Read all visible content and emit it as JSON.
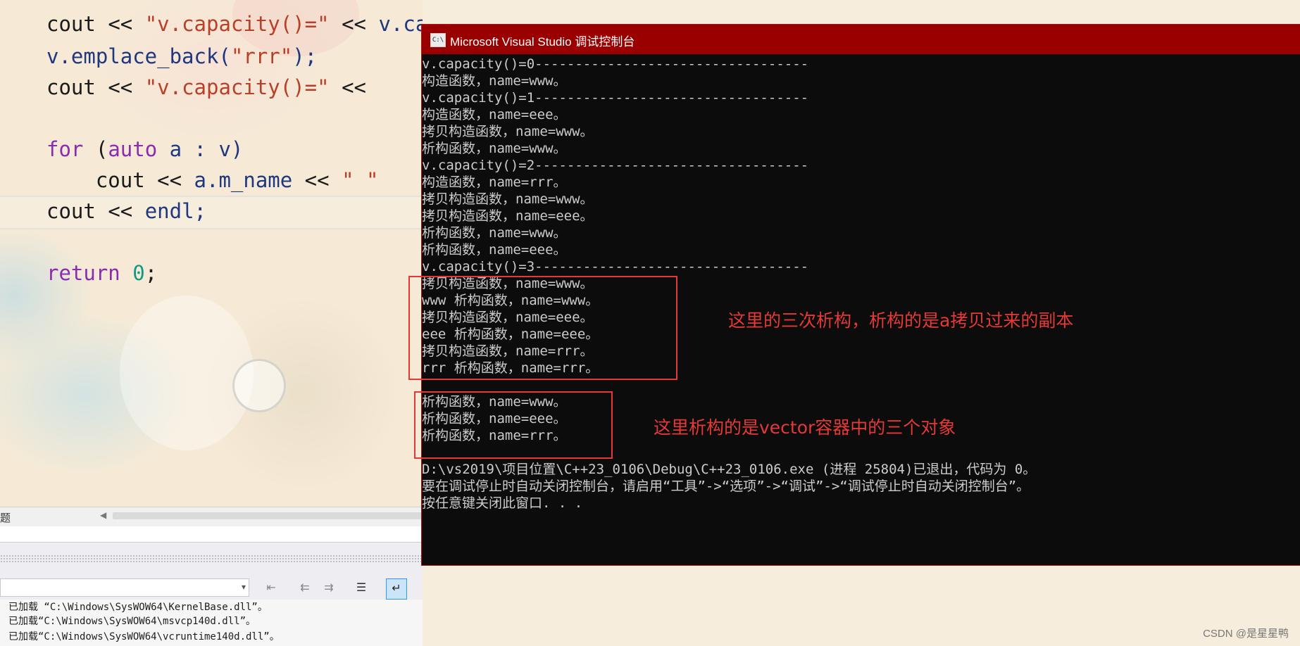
{
  "editor": {
    "lines": [
      {
        "parts": [
          [
            "op",
            "cout "
          ],
          [
            "op",
            "<< "
          ],
          [
            "str",
            "\"v.capacity()=\""
          ],
          [
            "op",
            " << "
          ],
          [
            "ident",
            "v.capacity() << \""
          ]
        ]
      },
      {
        "parts": [
          [
            "ident",
            "v.emplace_back("
          ],
          [
            "str",
            "\"rrr\""
          ],
          [
            "ident",
            ");"
          ]
        ]
      },
      {
        "parts": [
          [
            "op",
            "cout "
          ],
          [
            "op",
            "<< "
          ],
          [
            "str",
            "\"v.capacity()=\""
          ],
          [
            "op",
            " <<"
          ]
        ]
      },
      {
        "parts": []
      },
      {
        "parts": [
          [
            "kw",
            "for "
          ],
          [
            "op",
            "("
          ],
          [
            "kw",
            "auto "
          ],
          [
            "ident",
            "a : v)"
          ]
        ]
      },
      {
        "parts": [
          [
            "op",
            "    cout "
          ],
          [
            "op",
            "<< "
          ],
          [
            "ident",
            "a.m_name "
          ],
          [
            "op",
            "<< "
          ],
          [
            "str",
            "\" \""
          ]
        ]
      },
      {
        "parts": [
          [
            "op",
            "cout "
          ],
          [
            "op",
            "<< "
          ],
          [
            "ident",
            "endl;"
          ]
        ]
      },
      {
        "parts": []
      },
      {
        "parts": [
          [
            "kw",
            "return "
          ],
          [
            "num",
            "0"
          ],
          [
            "op",
            ";"
          ]
        ]
      }
    ]
  },
  "vs": {
    "tab_label": "题",
    "output_lines": [
      "已加载 “C:\\Windows\\SysWOW64\\KernelBase.dll”。",
      "已加载“C:\\Windows\\SysWOW64\\msvcp140d.dll”。",
      "已加载“C:\\Windows\\SysWOW64\\vcruntime140d.dll”。"
    ]
  },
  "console": {
    "title": "Microsoft Visual Studio 调试控制台",
    "icon_text": "C:\\",
    "lines": [
      "v.capacity()=0----------------------------------",
      "构造函数，name=www。",
      "v.capacity()=1----------------------------------",
      "构造函数，name=eee。",
      "拷贝构造函数，name=www。",
      "析构函数，name=www。",
      "v.capacity()=2----------------------------------",
      "构造函数，name=rrr。",
      "拷贝构造函数，name=www。",
      "拷贝构造函数，name=eee。",
      "析构函数，name=www。",
      "析构函数，name=eee。",
      "v.capacity()=3----------------------------------",
      "拷贝构造函数，name=www。",
      "www 析构函数，name=www。",
      "拷贝构造函数，name=eee。",
      "eee 析构函数，name=eee。",
      "拷贝构造函数，name=rrr。",
      "rrr 析构函数，name=rrr。",
      "",
      "析构函数，name=www。",
      "析构函数，name=eee。",
      "析构函数，name=rrr。",
      "",
      "D:\\vs2019\\项目位置\\C++23_0106\\Debug\\C++23_0106.exe (进程 25804)已退出，代码为 0。",
      "要在调试停止时自动关闭控制台，请启用“工具”->“选项”->“调试”->“调试停止时自动关闭控制台”。",
      "按任意键关闭此窗口. . ."
    ]
  },
  "annotations": {
    "note1": "这里的三次析构，析构的是a拷贝过来的副本",
    "note2": "这里析构的是vector容器中的三个对象",
    "color": "#e53935"
  },
  "watermark": "CSDN @是星星鸭"
}
